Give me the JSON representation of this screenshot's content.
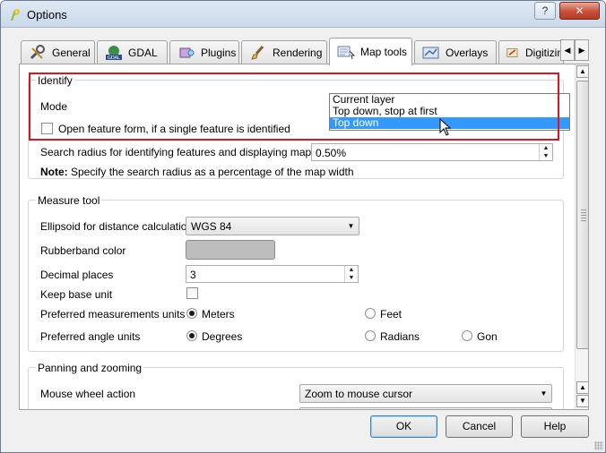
{
  "window": {
    "title": "Options",
    "help_label": "?",
    "close_label": "✕"
  },
  "tabs": [
    {
      "label": "General",
      "icon": "wrench-icon"
    },
    {
      "label": "GDAL",
      "icon": "gdal-globe-icon"
    },
    {
      "label": "Plugins",
      "icon": "plugin-icon"
    },
    {
      "label": "Rendering",
      "icon": "brush-icon"
    },
    {
      "label": "Map tools",
      "icon": "map-tools-icon",
      "active": true
    },
    {
      "label": "Overlays",
      "icon": "overlays-icon"
    },
    {
      "label": "Digitizin",
      "icon": "digitizing-icon"
    }
  ],
  "tab_scroll": {
    "left": "◀",
    "right": "▶"
  },
  "identify": {
    "title": "Identify",
    "mode_label": "Mode",
    "mode_options": [
      "Current layer",
      "Top down, stop at first",
      "Top down"
    ],
    "mode_selected": "Top down",
    "open_form_label": "Open feature form, if a single feature is identified",
    "open_form_checked": false,
    "search_radius_label": "Search radius for identifying features and displaying map tips",
    "search_radius_value": "0.50%",
    "note_bold": "Note:",
    "note_text": " Specify the search radius as a percentage of the map width"
  },
  "measure": {
    "title": "Measure tool",
    "ellipsoid_label": "Ellipsoid for distance calculations",
    "ellipsoid_value": "WGS 84",
    "rubberband_label": "Rubberband color",
    "rubberband_color": "#bdbdbd",
    "decimal_label": "Decimal places",
    "decimal_value": "3",
    "keep_unit_label": "Keep base unit",
    "keep_unit_checked": false,
    "measure_units_label": "Preferred measurements units",
    "measure_units": [
      {
        "label": "Meters",
        "checked": true
      },
      {
        "label": "Feet",
        "checked": false
      }
    ],
    "angle_units_label": "Preferred angle units",
    "angle_units": [
      {
        "label": "Degrees",
        "checked": true
      },
      {
        "label": "Radians",
        "checked": false
      },
      {
        "label": "Gon",
        "checked": false
      }
    ]
  },
  "panning": {
    "title": "Panning and zooming",
    "wheel_label": "Mouse wheel action",
    "wheel_value": "Zoom to mouse cursor"
  },
  "buttons": {
    "ok": "OK",
    "cancel": "Cancel",
    "help": "Help"
  },
  "colors": {
    "highlight": "#e0141e",
    "selection": "#3399ff"
  }
}
